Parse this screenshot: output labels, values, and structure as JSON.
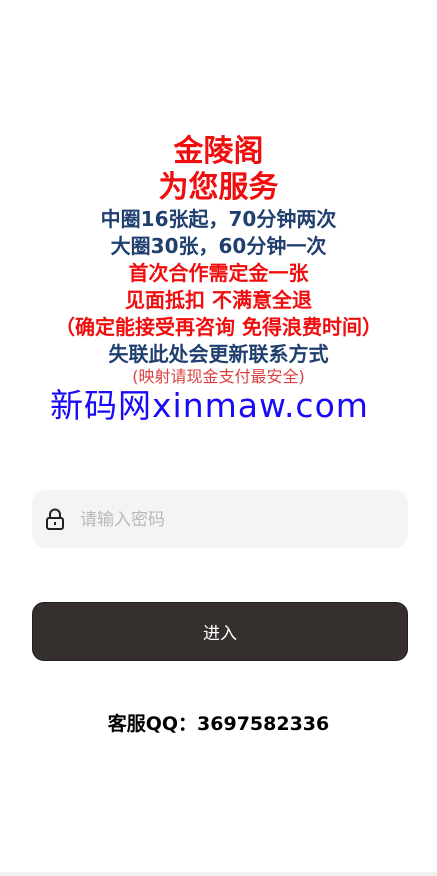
{
  "intro": {
    "title1": "金陵阁",
    "title2": "为您服务",
    "info1": "中圈16张起，70分钟两次",
    "info2": "大圈30张，60分钟一次",
    "notice1": "首次合作需定金一张",
    "notice2": "见面抵扣 不满意全退",
    "notice3": "（确定能接受再咨询 免得浪费时间）",
    "behind1": "失联此处会更新联系方式",
    "behind2": "(映射请现金支付最安全)"
  },
  "watermark": "新码网xinmaw.com",
  "login": {
    "password_placeholder": "请输入密码",
    "enter_label": "进入",
    "lock_icon": "lock-icon"
  },
  "contact": {
    "qq_label": "客服QQ：3697582336"
  },
  "colors": {
    "red": "#f00d0d",
    "navy": "#1f3f6e",
    "watermark_blue": "#1a0af5",
    "button_bg": "#352f2e",
    "input_bg": "#f4f4f4"
  }
}
